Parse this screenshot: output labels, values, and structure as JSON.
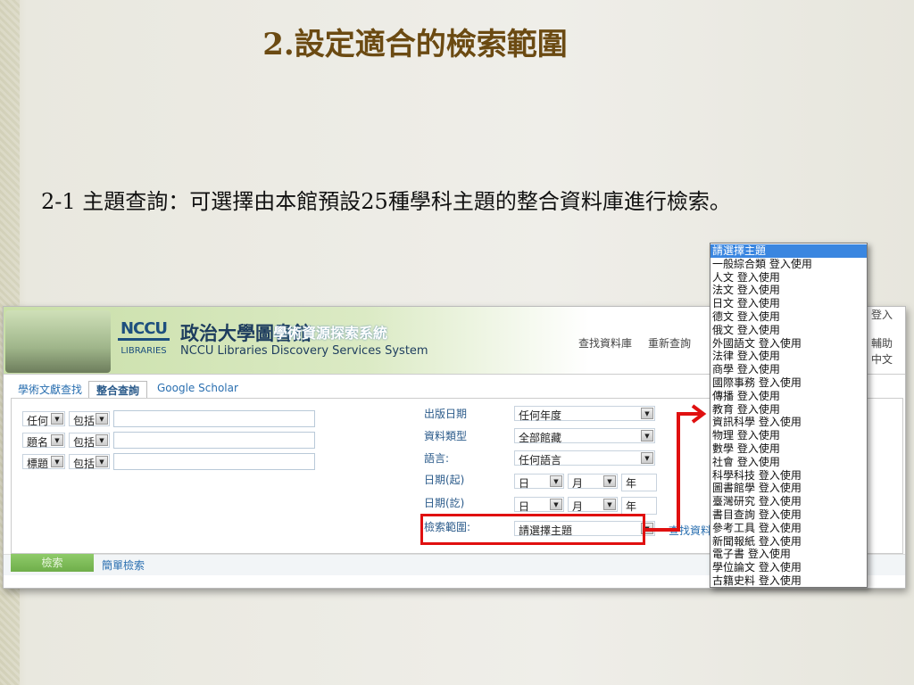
{
  "slide": {
    "title": "2.設定適合的檢索範圍",
    "subtitle": "2-1 主題查詢：可選擇由本館預設25種學科主題的整合資料庫進行檢索。"
  },
  "header": {
    "logo_top": "NCCU",
    "logo_bottom": "LIBRARIES",
    "title_cn": "政治大學圖書館",
    "title_sub": "學術資源探索系統",
    "title_en": "NCCU Libraries Discovery Services System",
    "nav": [
      "查找資料庫",
      "重新查詢"
    ],
    "login": "登入",
    "help": "輔助",
    "lang": "中文"
  },
  "tabs": [
    "學術文獻查找",
    "整合查詢",
    "Google Scholar"
  ],
  "left_rows": [
    {
      "field": "任何",
      "op": "包括"
    },
    {
      "field": "題名",
      "op": "包括"
    },
    {
      "field": "標題",
      "op": "包括"
    }
  ],
  "right": {
    "pub_date_label": "出版日期",
    "pub_date": "任何年度",
    "type_label": "資料類型",
    "type": "全部館藏",
    "lang_label": "語言:",
    "lang": "任何語言",
    "from_label": "日期(起)",
    "to_label": "日期(訖)",
    "day": "日",
    "month": "月",
    "year": "年",
    "scope_label": "檢索範圍:",
    "scope": "請選擇主題",
    "find_db": "查找資料庫"
  },
  "bottom": {
    "search": "檢索",
    "simple": "簡單檢索"
  },
  "dropdown": [
    "請選擇主題",
    "一般綜合類 登入使用",
    "人文 登入使用",
    "法文 登入使用",
    "日文 登入使用",
    "德文 登入使用",
    "俄文 登入使用",
    "外國語文 登入使用",
    "法律 登入使用",
    "商學 登入使用",
    "國際事務 登入使用",
    "傳播 登入使用",
    "教育 登入使用",
    "資訊科學 登入使用",
    "物理 登入使用",
    "數學 登入使用",
    "社會 登入使用",
    "科學科技 登入使用",
    "圖書館學 登入使用",
    "臺灣研究 登入使用",
    "書目查詢 登入使用",
    "參考工具 登入使用",
    "新聞報紙 登入使用",
    "電子書 登入使用",
    "學位論文 登入使用",
    "古籍史料 登入使用"
  ],
  "colors": {
    "title": "#6b4a12",
    "highlight": "#e01010",
    "selected": "#3a86e0"
  }
}
